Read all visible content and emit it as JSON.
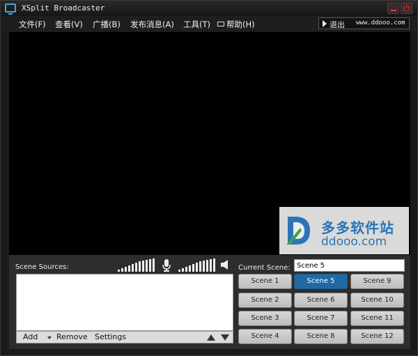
{
  "window": {
    "title": "XSplit Broadcaster"
  },
  "menu": {
    "items": [
      "文件(F)",
      "查看(V)",
      "广播(B)",
      "发布消息(A)",
      "工具(T)",
      "帮助(H)"
    ],
    "exit_label": "退出",
    "site": "www.ddooo.com"
  },
  "watermark": {
    "cn": "多多软件站",
    "en": "ddooo.com"
  },
  "sources": {
    "label": "Scene Sources:",
    "add": "Add",
    "remove": "Remove",
    "settings": "Settings",
    "items": []
  },
  "scenes": {
    "current_label": "Current Scene:",
    "current_value": "Scene 5",
    "active": "Scene 5",
    "buttons": [
      "Scene 1",
      "Scene 2",
      "Scene 3",
      "Scene 4",
      "Scene 5",
      "Scene 6",
      "Scene 7",
      "Scene 8",
      "Scene 9",
      "Scene 10",
      "Scene 11",
      "Scene 12"
    ]
  },
  "icons": [
    "app-icon",
    "minimize-icon",
    "power-icon",
    "mail-icon",
    "play-icon",
    "microphone-icon",
    "speaker-icon",
    "caret-down-icon",
    "arrow-up-icon",
    "arrow-down-icon"
  ],
  "colors": {
    "accent": "#1f6aa5",
    "brand": "#2b74b8"
  }
}
